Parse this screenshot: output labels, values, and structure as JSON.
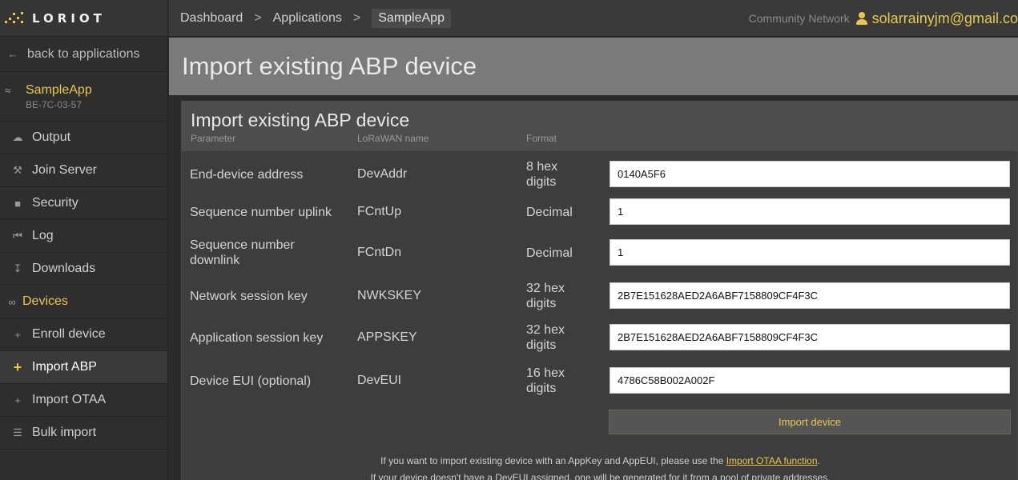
{
  "logo": {
    "text": "LORIOT"
  },
  "sidebar": {
    "back": "back to applications",
    "app_name": "SampleApp",
    "app_id": "BE-7C-03-57",
    "items": [
      {
        "label": "Output",
        "icon": "cloud-icon"
      },
      {
        "label": "Join Server",
        "icon": "wrench-icon"
      },
      {
        "label": "Security",
        "icon": "lock-icon"
      },
      {
        "label": "Log",
        "icon": "backward-icon"
      },
      {
        "label": "Downloads",
        "icon": "download-icon"
      },
      {
        "label": "Devices",
        "icon": "devices-icon"
      },
      {
        "label": "Enroll device",
        "icon": "plus-icon"
      },
      {
        "label": "Import ABP",
        "icon": "plus-icon"
      },
      {
        "label": "Import OTAA",
        "icon": "plus-icon"
      },
      {
        "label": "Bulk import",
        "icon": "list-icon"
      }
    ]
  },
  "topbar": {
    "crumbs": [
      "Dashboard",
      "Applications",
      "SampleApp"
    ],
    "network": "Community Network",
    "user": "solarrainyjm@gmail.co"
  },
  "page": {
    "title": "Import existing ABP device"
  },
  "panel": {
    "title": "Import existing ABP device",
    "headers": {
      "parameter": "Parameter",
      "lorawan": "LoRaWAN name",
      "format": "Format"
    },
    "rows": [
      {
        "param": "End-device address",
        "name": "DevAddr",
        "format": "8 hex digits",
        "value": "0140A5F6"
      },
      {
        "param": "Sequence number uplink",
        "name": "FCntUp",
        "format": "Decimal",
        "value": "1"
      },
      {
        "param": "Sequence number downlink",
        "name": "FCntDn",
        "format": "Decimal",
        "value": "1"
      },
      {
        "param": "Network session key",
        "name": "NWKSKEY",
        "format": "32 hex digits",
        "value": "2B7E151628AED2A6ABF7158809CF4F3C"
      },
      {
        "param": "Application session key",
        "name": "APPSKEY",
        "format": "32 hex digits",
        "value": "2B7E151628AED2A6ABF7158809CF4F3C"
      },
      {
        "param": "Device EUI (optional)",
        "name": "DevEUI",
        "format": "16 hex digits",
        "value": "4786C58B002A002F"
      }
    ],
    "import_button": "Import device",
    "note1_pre": "If you want to import existing device with an AppKey and AppEUI, please use the ",
    "note1_link": "Import OTAA function",
    "note1_post": ".",
    "note2": "If your device doesn't have a DevEUI assigned, one will be generated for it from a pool of private addresses."
  },
  "colors": {
    "accent": "#e8c84a",
    "sidebar": "#2e2e2e",
    "title_band": "#7a7a7a",
    "panel": "#3d3d3d"
  }
}
